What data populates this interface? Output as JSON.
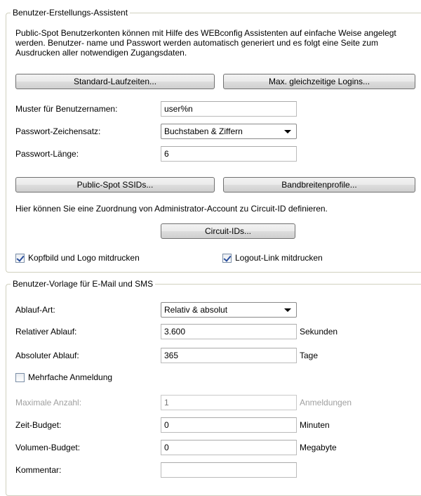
{
  "wizard": {
    "legend": "Benutzer-Erstellungs-Assistent",
    "description": "Public-Spot Benutzerkonten können mit Hilfe des WEBconfig Assistenten auf einfache Weise angelegt werden. Benutzer- name und Passwort werden automatisch generiert und es folgt eine Seite zum Ausdrucken aller notwendigen Zugangsdaten.",
    "btn_runtimes": "Standard-Laufzeiten...",
    "btn_max_logins": "Max. gleichzeitige Logins...",
    "username_pattern_label": "Muster für Benutzernamen:",
    "username_pattern_value": "user%n",
    "charset_label": "Passwort-Zeichensatz:",
    "charset_value": "Buchstaben & Ziffern",
    "password_length_label": "Passwort-Länge:",
    "password_length_value": "6",
    "btn_ssids": "Public-Spot SSIDs...",
    "btn_bandwidth": "Bandbreitenprofile...",
    "circuit_text": "Hier können Sie eine Zuordnung von Administrator-Account zu Circuit-ID definieren.",
    "btn_circuit": "Circuit-IDs...",
    "print_header_label": "Kopfbild und Logo mitdrucken",
    "print_header_checked": true,
    "print_logout_label": "Logout-Link mitdrucken",
    "print_logout_checked": true
  },
  "template": {
    "legend": "Benutzer-Vorlage für E-Mail und SMS",
    "expiry_type_label": "Ablauf-Art:",
    "expiry_type_value": "Relativ & absolut",
    "relative_label": "Relativer Ablauf:",
    "relative_value": "3.600",
    "relative_unit": "Sekunden",
    "absolute_label": "Absoluter Ablauf:",
    "absolute_value": "365",
    "absolute_unit": "Tage",
    "multiple_login_label": "Mehrfache Anmeldung",
    "multiple_login_checked": false,
    "max_count_label": "Maximale Anzahl:",
    "max_count_value": "1",
    "max_count_unit": "Anmeldungen",
    "time_budget_label": "Zeit-Budget:",
    "time_budget_value": "0",
    "time_budget_unit": "Minuten",
    "volume_budget_label": "Volumen-Budget:",
    "volume_budget_value": "0",
    "volume_budget_unit": "Megabyte",
    "comment_label": "Kommentar:",
    "comment_value": ""
  }
}
